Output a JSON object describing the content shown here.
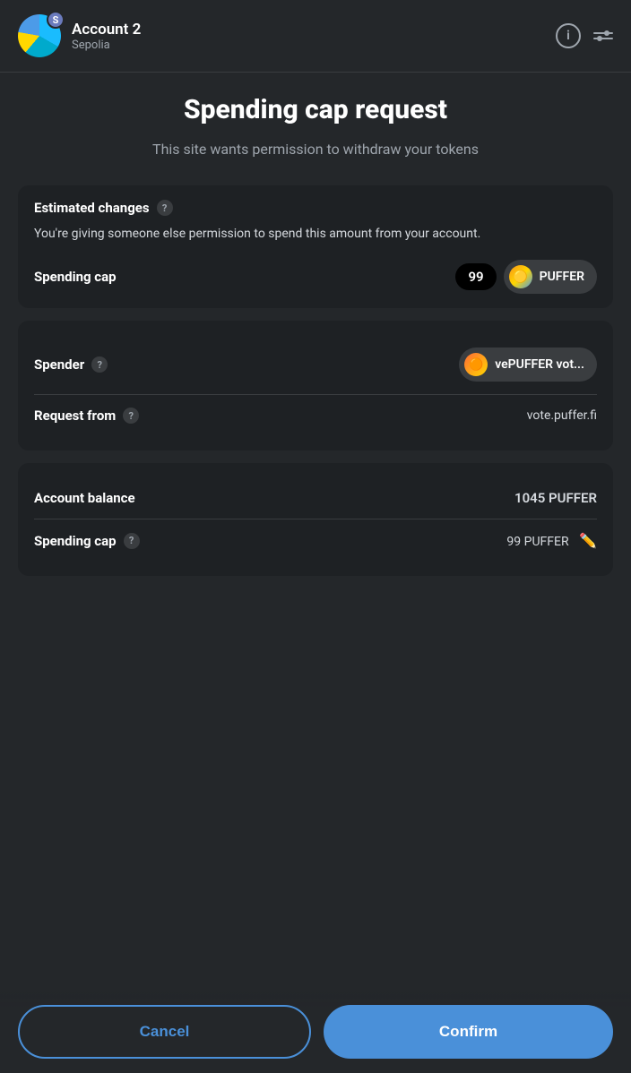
{
  "header": {
    "account_name": "Account 2",
    "network": "Sepolia",
    "avatar_badge": "S",
    "info_icon_label": "i"
  },
  "page": {
    "title": "Spending cap request",
    "subtitle": "This site wants permission to withdraw your tokens"
  },
  "estimated_changes": {
    "label": "Estimated changes",
    "help_label": "?",
    "description": "You're giving someone else permission to spend this amount from your account.",
    "spending_cap_label": "Spending cap",
    "spending_cap_number": "99",
    "token_name": "PUFFER"
  },
  "spender_card": {
    "spender_label": "Spender",
    "spender_help": "?",
    "spender_name": "vePUFFER vot...",
    "request_from_label": "Request from",
    "request_from_help": "?",
    "request_from_value": "vote.puffer.fi"
  },
  "balance_card": {
    "balance_label": "Account balance",
    "balance_value": "1045 PUFFER",
    "spending_cap_label": "Spending cap",
    "spending_cap_help": "?",
    "spending_cap_value": "99 PUFFER"
  },
  "buttons": {
    "cancel_label": "Cancel",
    "confirm_label": "Confirm"
  }
}
